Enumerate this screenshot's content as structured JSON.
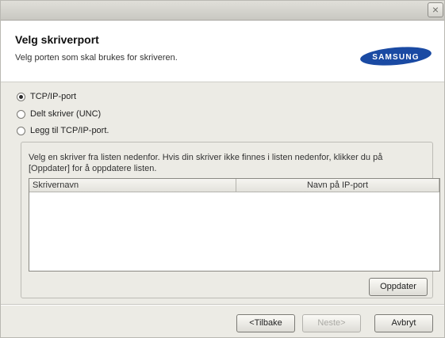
{
  "header": {
    "title": "Velg skriverport",
    "subtitle": "Velg porten som skal brukes for skriveren.",
    "logo_text": "SAMSUNG"
  },
  "title_bar": {
    "close_glyph": "×"
  },
  "port_options": [
    {
      "label": "TCP/IP-port",
      "checked": true
    },
    {
      "label": "Delt skriver (UNC)",
      "checked": false
    },
    {
      "label": "Legg til TCP/IP-port.",
      "checked": false
    }
  ],
  "group": {
    "instruction": "Velg en skriver fra listen nedenfor. Hvis din skriver ikke finnes i listen nedenfor, klikker du på [Oppdater] for å oppdatere listen.",
    "columns": [
      "Skrivernavn",
      "Navn på IP-port"
    ],
    "refresh_label": "Oppdater"
  },
  "footer": {
    "back_label": "<Tilbake",
    "next_label": "Neste>",
    "cancel_label": "Avbryt"
  },
  "colors": {
    "logo": "#1a4aa3",
    "dialog_bg": "#ecebe5",
    "header_bg": "#ffffff"
  },
  "icons": {
    "close": "close-icon"
  }
}
